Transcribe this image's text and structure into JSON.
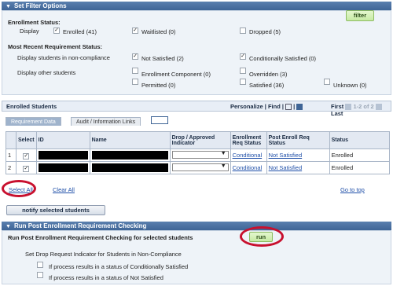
{
  "filter": {
    "title": "Set Filter Options",
    "filter_button": "filter",
    "enrollment_status_heading": "Enrollment Status:",
    "display_label": "Display",
    "enrolled": "Enrolled (41)",
    "waitlisted": "Waitlisted (0)",
    "dropped": "Dropped (5)",
    "req_status_heading": "Most Recent Requirement Status:",
    "noncompliance_label": "Display students in non-compliance",
    "not_satisfied": "Not Satisfied (2)",
    "cond_satisfied": "Conditionally Satisfied (0)",
    "other_label": "Display other students",
    "enrollment_component": "Enrollment Component (0)",
    "overridden": "Overridden (3)",
    "permitted": "Permitted (0)",
    "satisfied": "Satisfied (36)",
    "unknown": "Unknown (0)"
  },
  "enrolled": {
    "title": "Enrolled Students",
    "personalize": "Personalize",
    "find": "Find",
    "first": "First",
    "pager_mid": "1-2 of 2",
    "last": "Last",
    "tab_requirement": "Requirement Data",
    "tab_audit": "Audit / Information Links",
    "columns": {
      "select": "Select",
      "id": "ID",
      "name": "Name",
      "drop": "Drop / Approved Indicator",
      "enroll_req": "Enrollment Req Status",
      "post_enroll": "Post Enroll Req Status",
      "status": "Status"
    },
    "rows": [
      {
        "num": "1",
        "enroll_req": "Conditional",
        "post_enroll": "Not Satisfied",
        "status": "Enrolled"
      },
      {
        "num": "2",
        "enroll_req": "Conditional",
        "post_enroll": "Not Satisfied",
        "status": "Enrolled"
      }
    ]
  },
  "actions": {
    "select_all": "Select All",
    "clear_all": "Clear All",
    "go_to_top": "Go to top",
    "notify": "notify selected students"
  },
  "run": {
    "title": "Run Post Enrollment Requirement Checking",
    "heading": "Run Post Enrollment Requirement Checking for selected students",
    "run_button": "run",
    "sub": "Set Drop Request Indicator for Students in Non-Compliance",
    "opt_cond": "If process results in a status of Conditionally Satisfied",
    "opt_not": "If process results in a status of Not Satisfied"
  }
}
